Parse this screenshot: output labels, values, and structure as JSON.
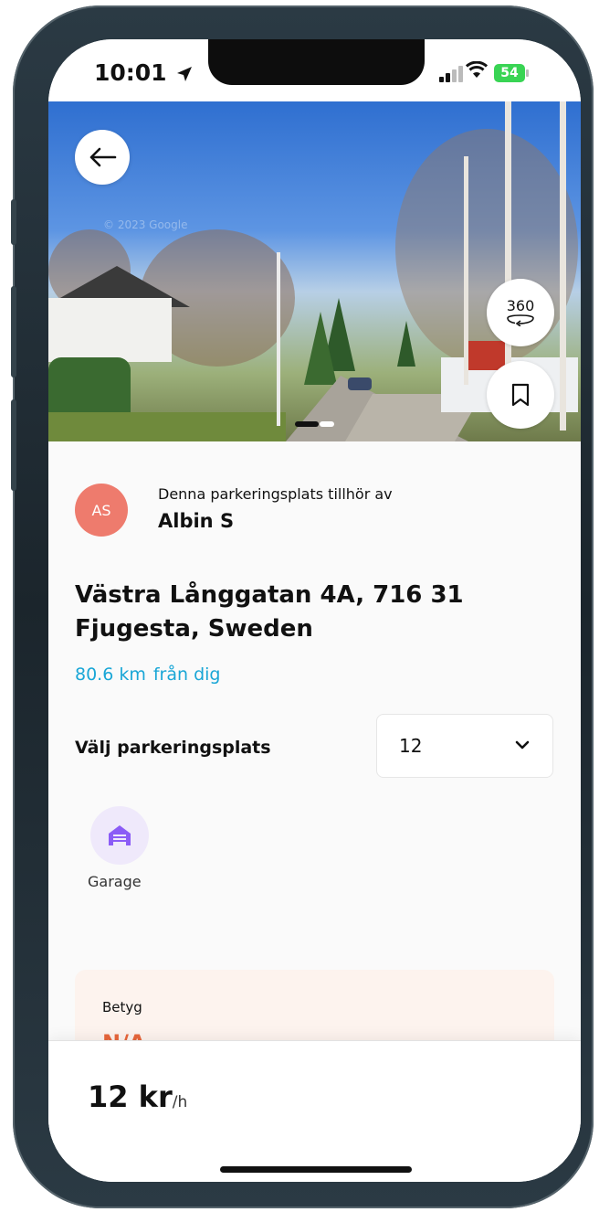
{
  "status_bar": {
    "time": "10:01",
    "battery": "54"
  },
  "photo": {
    "watermark": "© 2023 Google"
  },
  "owner": {
    "avatar_initials": "AS",
    "label": "Denna parkeringsplats tillhör av",
    "name": "Albin S"
  },
  "address": "Västra Långgatan 4A, 716 31 Fjugesta, Sweden",
  "distance": {
    "value": "80.6 km",
    "suffix": "från dig"
  },
  "spot_select": {
    "label": "Välj parkeringsplats",
    "selected": "12"
  },
  "features": [
    {
      "icon": "garage-icon",
      "label": "Garage"
    }
  ],
  "rating": {
    "title": "Betyg",
    "value": "N/A"
  },
  "price": {
    "amount": "12 kr",
    "unit": "/h"
  },
  "colors": {
    "accent": "#19a6d6",
    "avatar": "#ee7b6d",
    "rating_value": "#e8663b",
    "feature_bg": "#efe9fb",
    "feature_icon": "#8b5cf6"
  }
}
